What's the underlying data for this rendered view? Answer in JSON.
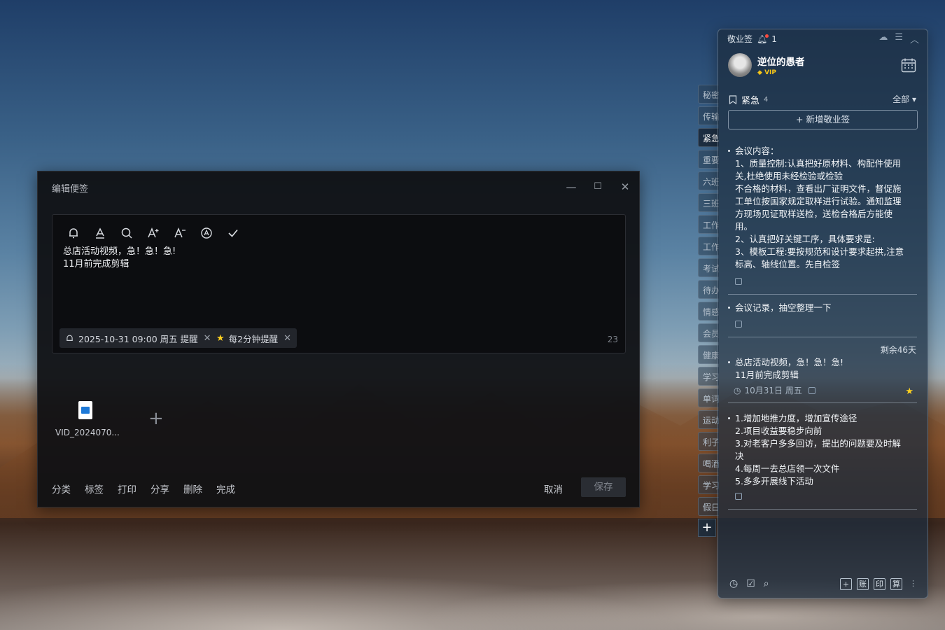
{
  "editor": {
    "title": "编辑便签",
    "window_controls": {
      "minimize": "—",
      "maximize": "☐",
      "close": "✕"
    },
    "toolbar_icons": [
      "bell-icon",
      "text-color-icon",
      "search-icon",
      "font-increase-icon",
      "font-decrease-icon",
      "font-style-icon",
      "check-icon"
    ],
    "text_line1": "总店活动视频，急！急！急!",
    "text_line2": "11月前完成剪辑",
    "reminder_chip": "2025-10-31 09:00 周五 提醒",
    "interval_chip": "每2分钟提醒",
    "char_count": "23",
    "attachment_name": "VID_2024070...",
    "actions": [
      "分类",
      "标签",
      "打印",
      "分享",
      "删除",
      "完成"
    ],
    "cancel_label": "取消",
    "save_label": "保存"
  },
  "sidetabs": [
    "秘密",
    "传输",
    "紧急",
    "重要",
    "六班",
    "三班",
    "工作",
    "工作",
    "考试",
    "待办",
    "情感",
    "会员",
    "健康",
    "学习",
    "单词",
    "运动",
    "利子",
    "喝酒",
    "学习",
    "假日"
  ],
  "sidetab_active_index": 2,
  "panel": {
    "app_name": "敬业签",
    "notify_count": "1",
    "user_name": "逆位的愚者",
    "vip_label": "VIP",
    "category_name": "紧急",
    "category_count": "4",
    "filter_label": "全部 ▾",
    "new_note_label": "+ 新增敬业签",
    "notes": [
      {
        "lines": [
          "会议内容：",
          "1、质量控制:认真把好原材料、构配件使用",
          "关,杜绝使用未经检验或检验",
          "不合格的材料，查看出厂证明文件，督促施",
          "工单位按国家规定取样进行试验。通知监理",
          "方现场见证取样送检，送检合格后方能使",
          "用。",
          "2、认真把好关键工序，具体要求是:",
          "3、模板工程:要按规范和设计要求起拱,注意",
          "标高、轴线位置。先自检签"
        ]
      },
      {
        "lines": [
          "会议记录，抽空整理一下"
        ]
      },
      {
        "remaining": "剩余46天",
        "lines": [
          "总店活动视频，急！急！急!",
          "11月前完成剪辑"
        ],
        "date": "10月31日 周五"
      },
      {
        "lines": [
          "1.增加地推力度，增加宣传途径",
          "2.项目收益要稳步向前",
          "3.对老客户多多回访，提出的问题要及时解",
          "决",
          "4.每周一去总店领一次文件",
          "5.多多开展线下活动"
        ]
      }
    ],
    "footer_right": [
      "+",
      "账",
      "印",
      "算"
    ],
    "footer_left_icons": [
      "clock-icon",
      "checkbox-icon",
      "search-icon"
    ]
  },
  "colors": {
    "accent_star": "#ffd21f",
    "notify_dot": "#ff4b3e",
    "vip_gold": "#f5c518"
  }
}
